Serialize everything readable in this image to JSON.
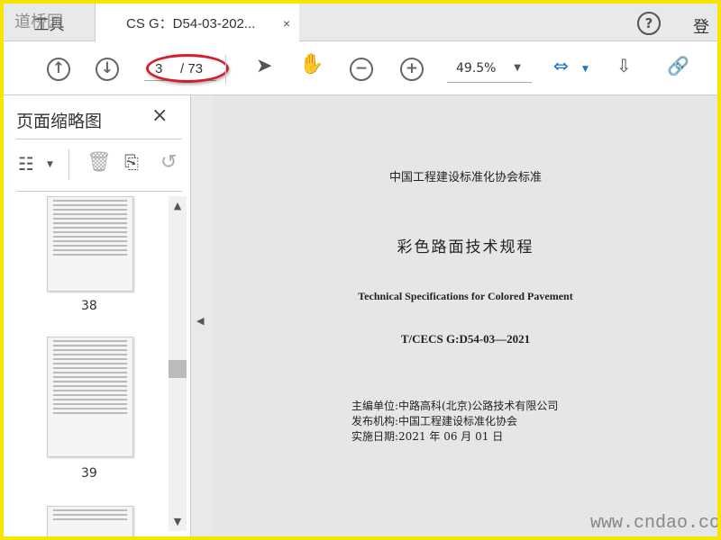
{
  "tabs": {
    "tools": "工具",
    "document": "CS G：D54-03-202...",
    "close": "×"
  },
  "header": {
    "help": "?",
    "login": "登录"
  },
  "watermark_top": "道桥园",
  "toolbar": {
    "page_current": "3",
    "page_total": "/ 73",
    "zoom": "49.5%"
  },
  "sidebar": {
    "title": "页面缩略图",
    "close": "×",
    "thumbnails": [
      {
        "label": "38"
      },
      {
        "label": "39"
      }
    ]
  },
  "document": {
    "org_header": "中国工程建设标准化协会标准",
    "title_cn": "彩色路面技术规程",
    "title_en": "Technical Specifications for Colored Pavement",
    "code": "T/CECS G:D54-03—2021",
    "editor": "主编单位:中路高科(北京)公路技术有限公司",
    "publisher": "发布机构:中国工程建设标准化协会",
    "effective": "实施日期:2021 年 06 月 01 日"
  },
  "watermark_bottom": "www.cndao.com",
  "colors": {
    "accent": "#1e73c8",
    "highlight": "#d4202a",
    "frame": "#f5e600"
  }
}
